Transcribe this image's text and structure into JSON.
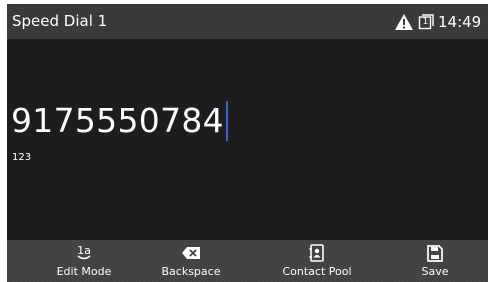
{
  "statusbar": {
    "title": "Speed Dial 1",
    "alert_icon": "warning-triangle-icon",
    "device_icon": "phone-lines-icon",
    "device_icon_digit": "1",
    "time": "14:49"
  },
  "input": {
    "value": "9175550784",
    "mode": "123"
  },
  "softkeys": [
    {
      "label": "Edit Mode",
      "icon": "edit-mode-icon",
      "icon_text": "1a"
    },
    {
      "label": "Backspace",
      "icon": "backspace-icon"
    },
    {
      "label": "Contact Pool",
      "icon": "contact-book-icon"
    },
    {
      "label": "Save",
      "icon": "save-icon"
    }
  ],
  "colors": {
    "background": "#1d1d1d",
    "statusbar": "#3a3a3a",
    "softkey_bar": "#414141",
    "caret": "#3b5fd8",
    "text": "#ffffff"
  }
}
